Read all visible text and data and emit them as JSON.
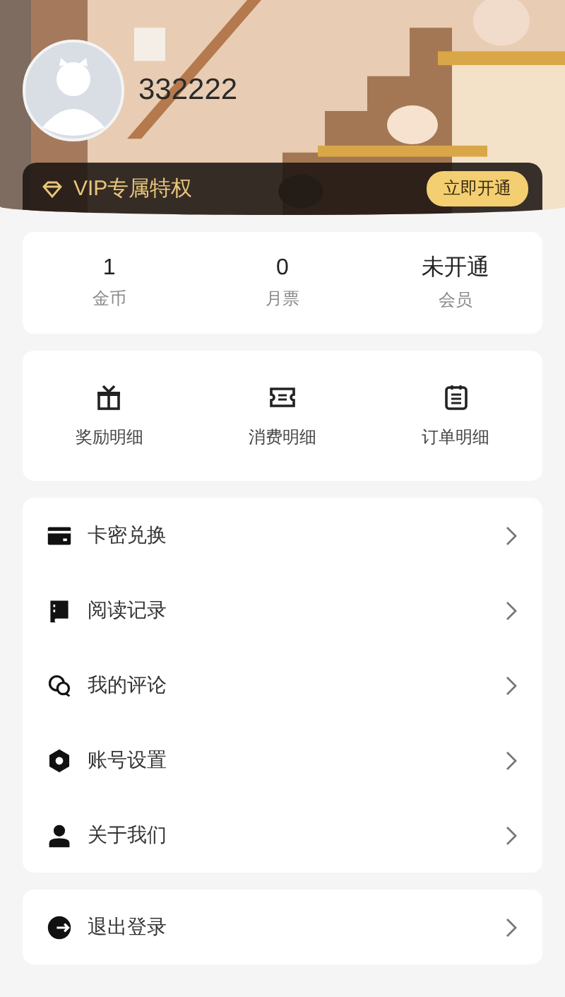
{
  "user": {
    "name": "332222"
  },
  "vip": {
    "label": "VIP专属特权",
    "button": "立即开通"
  },
  "stats": [
    {
      "value": "1",
      "label": "金币"
    },
    {
      "value": "0",
      "label": "月票"
    },
    {
      "value": "未开通",
      "label": "会员"
    }
  ],
  "shortcuts": [
    {
      "label": "奖励明细"
    },
    {
      "label": "消费明细"
    },
    {
      "label": "订单明细"
    }
  ],
  "menu": [
    {
      "label": "卡密兑换"
    },
    {
      "label": "阅读记录"
    },
    {
      "label": "我的评论"
    },
    {
      "label": "账号设置"
    },
    {
      "label": "关于我们"
    }
  ],
  "logout": {
    "label": "退出登录"
  }
}
